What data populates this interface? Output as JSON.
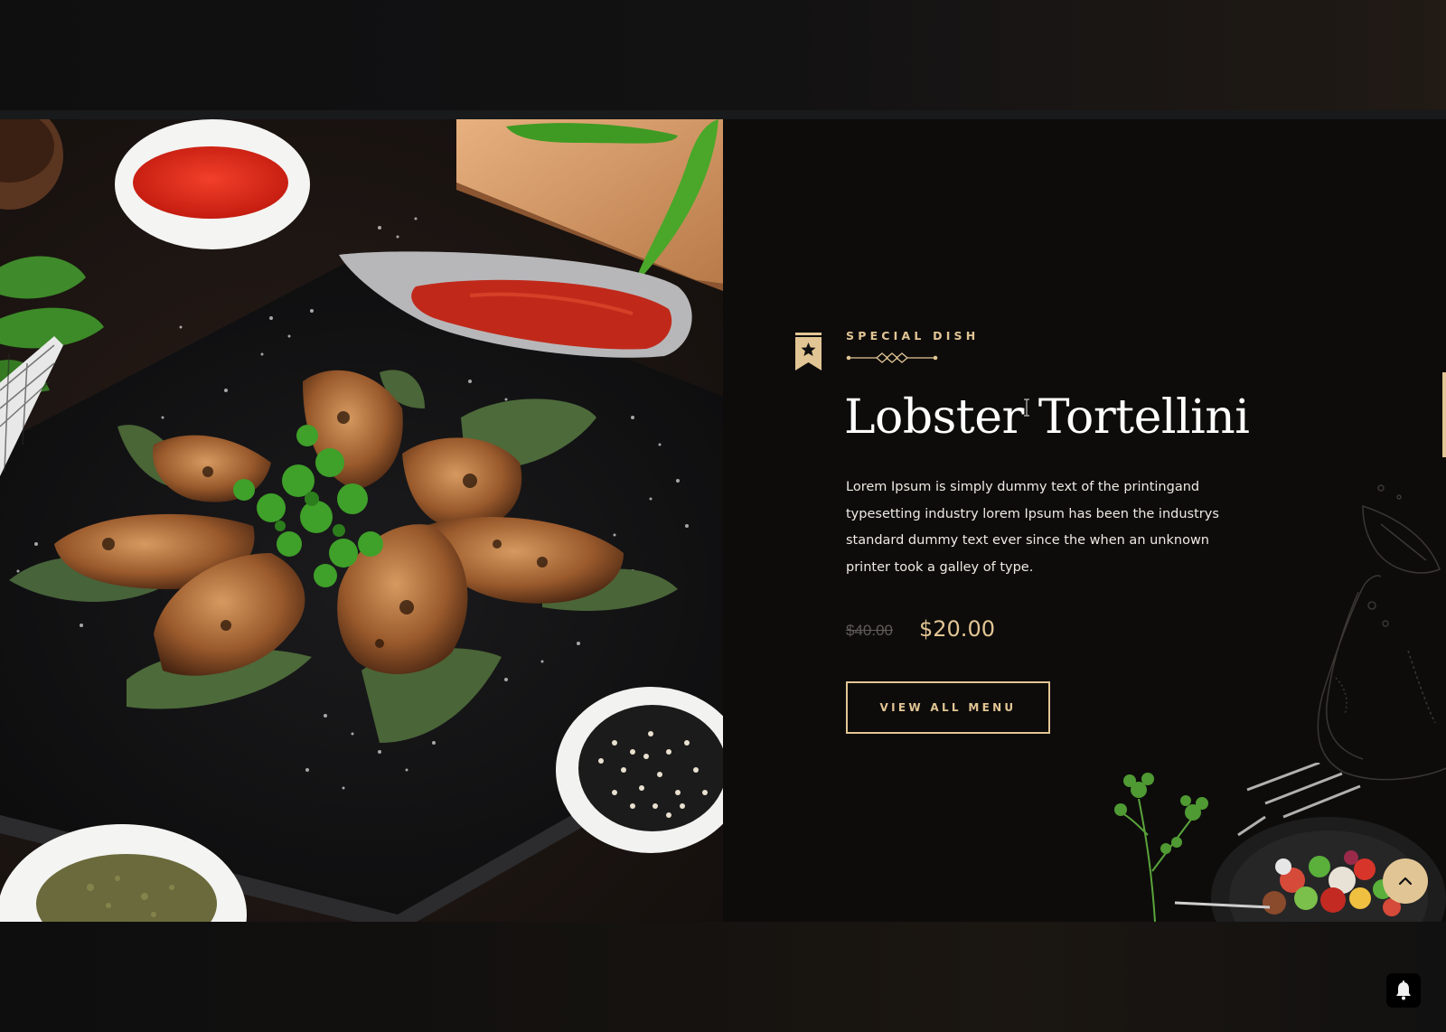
{
  "special_dish": {
    "subtitle": "SPECIAL DISH",
    "title": "Lobster Tortellini",
    "description": "Lorem Ipsum is simply dummy text of the printingand typesetting industry lorem Ipsum has been the industrys standard dummy text ever since the when an unknown printer took a galley of type.",
    "old_price": "$40.00",
    "new_price": "$20.00",
    "button_label": "VIEW ALL MENU"
  },
  "icons": {
    "badge": "bookmark-star-icon",
    "scroll_top": "chevron-up-icon",
    "notification": "bell-icon"
  },
  "colors": {
    "accent_gold": "#e2c594",
    "background": "#0d0c0b",
    "text": "#ffffff",
    "muted_price": "#5f5b56"
  }
}
